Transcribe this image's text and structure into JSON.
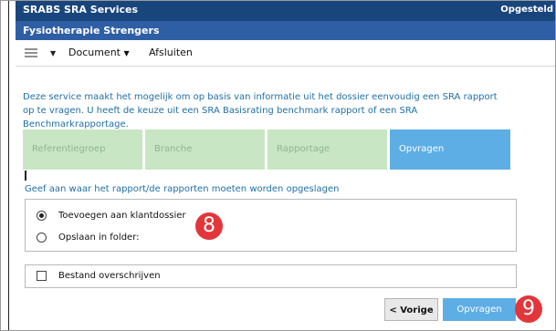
{
  "header": {
    "app_title": "SRABS SRA Services",
    "status": "Opgesteld",
    "company": "Fysiotherapie Strengers"
  },
  "menu": {
    "document_label": "Document",
    "close_label": "Afsluiten"
  },
  "description": "Deze service maakt het mogelijk om op basis van informatie uit het dossier eenvoudig een SRA rapport op te vragen. U heeft de keuze uit een SRA Basisrating benchmark rapport of een SRA Benchmarkrapportage.",
  "steps": [
    {
      "label": "Referentiegroep",
      "active": false
    },
    {
      "label": "Branche",
      "active": false
    },
    {
      "label": "Rapportage",
      "active": false
    },
    {
      "label": "Opvragen",
      "active": true
    }
  ],
  "instruction": "Geef aan waar het rapport/de rapporten moeten worden opgeslagen",
  "storage_options": [
    {
      "label": "Toevoegen aan klantdossier",
      "selected": true
    },
    {
      "label": "Opslaan in folder:",
      "selected": false
    }
  ],
  "overwrite": {
    "label": "Bestand overschrijven",
    "checked": false
  },
  "buttons": {
    "previous": "< Vorige",
    "submit": "Opvragen"
  },
  "annotations": {
    "options_marker": "8",
    "submit_marker": "9"
  },
  "colors": {
    "title_bar": "#19457d",
    "sub_bar": "#2e5ea4",
    "step_inactive": "#c8e6c3",
    "step_active": "#5eaee6",
    "marker": "#e2363a"
  }
}
